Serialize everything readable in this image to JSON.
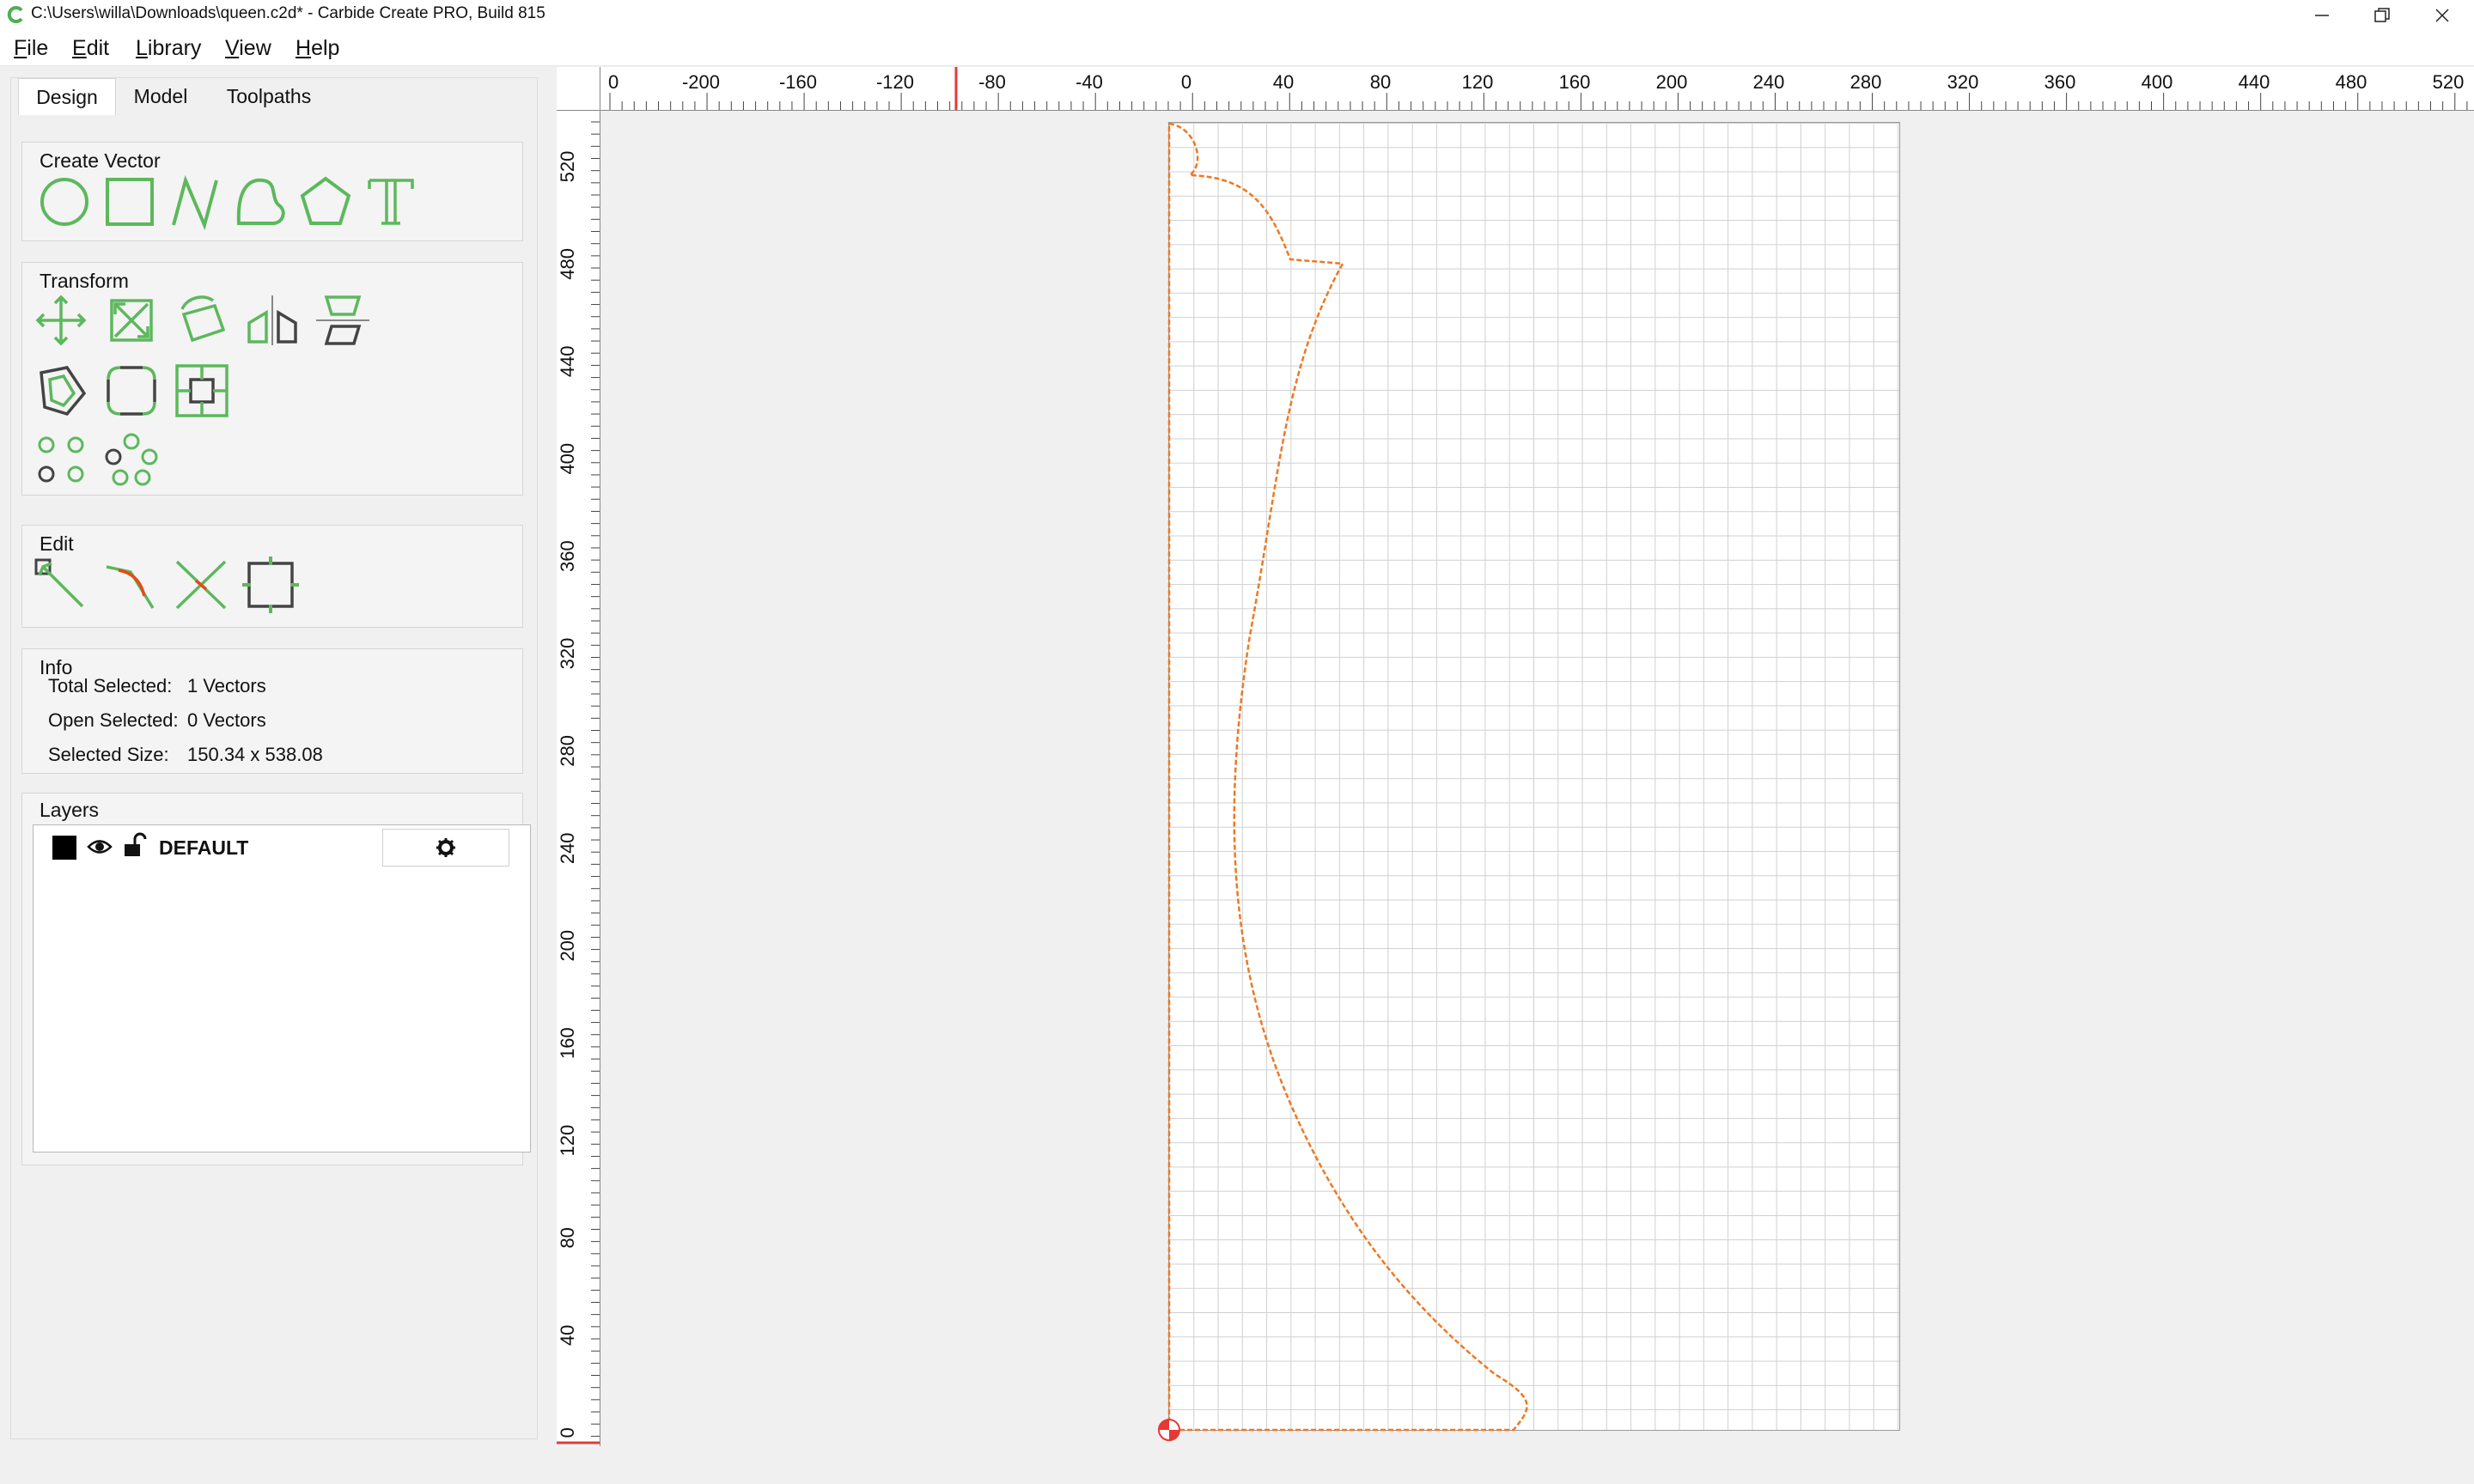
{
  "window": {
    "title": "C:\\Users\\willa\\Downloads\\queen.c2d* - Carbide Create PRO, Build 815"
  },
  "menu": [
    "File",
    "Edit",
    "Library",
    "View",
    "Help"
  ],
  "tabs": [
    "Design",
    "Model",
    "Toolpaths"
  ],
  "active_tab": "Design",
  "create_vector": {
    "title": "Create Vector",
    "tools": [
      "circle-icon",
      "rectangle-icon",
      "polyline-icon",
      "curve-icon",
      "polygon-icon",
      "text-icon"
    ]
  },
  "transform": {
    "title": "Transform",
    "tools": [
      "move-icon",
      "scale-icon",
      "rotate-icon",
      "mirror-icon",
      "align-icon",
      "offset-icon",
      "fillet-icon",
      "boolean-icon",
      "array-icon",
      "circular-array-icon"
    ]
  },
  "edit": {
    "title": "Edit",
    "tools": [
      "node-edit-icon",
      "smooth-icon",
      "trim-icon",
      "bounding-box-icon"
    ]
  },
  "info": {
    "title": "Info",
    "total_selected_label": "Total Selected:",
    "total_selected_value": "1 Vectors",
    "open_selected_label": "Open Selected:",
    "open_selected_value": "0 Vectors",
    "selected_size_label": "Selected Size:",
    "selected_size_value": "150.34 x 538.08"
  },
  "layers": {
    "title": "Layers",
    "items": [
      {
        "name": "DEFAULT",
        "color": "#000000",
        "visible": true,
        "locked": false
      }
    ]
  },
  "ruler": {
    "top_labels": [
      "0",
      "-200",
      "-160",
      "-120",
      "-80",
      "-40",
      "0",
      "40",
      "80",
      "120",
      "160",
      "200",
      "240",
      "280",
      "320",
      "360",
      "400",
      "440",
      "480",
      "520"
    ],
    "left_labels": [
      "520",
      "480",
      "440",
      "400",
      "360",
      "320",
      "280",
      "240",
      "200",
      "160",
      "120",
      "80",
      "40",
      "0"
    ]
  },
  "colors": {
    "accent_green": "#5cb85c",
    "vector_orange": "#f07820",
    "ruler_marker": "#e53935"
  }
}
